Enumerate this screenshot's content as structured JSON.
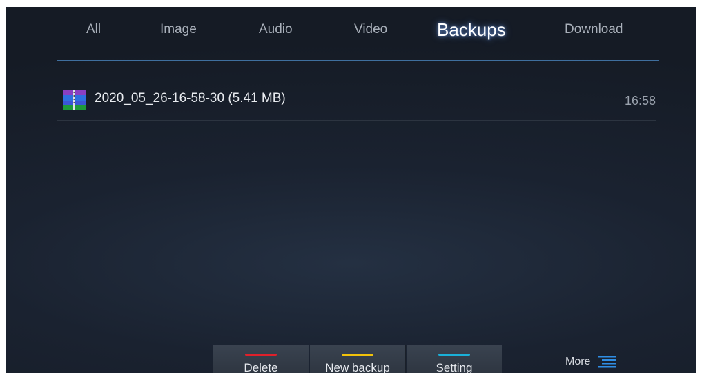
{
  "tabs": [
    {
      "label": "All",
      "active": false
    },
    {
      "label": "Image",
      "active": false
    },
    {
      "label": "Audio",
      "active": false
    },
    {
      "label": "Video",
      "active": false
    },
    {
      "label": "Backups",
      "active": true
    },
    {
      "label": "Download",
      "active": false
    }
  ],
  "files": [
    {
      "icon": "archive-icon",
      "name": "2020_05_26-16-58-30 (5.41 MB)",
      "time": "16:58"
    }
  ],
  "actions": [
    {
      "label": "Delete",
      "color": "#e0202a"
    },
    {
      "label": "New backup",
      "color": "#f2c20a"
    },
    {
      "label": "Setting",
      "color": "#1ab0d8"
    }
  ],
  "more": {
    "label": "More",
    "icon": "menu-lines-icon",
    "color": "#2f8de4"
  },
  "colors": {
    "accent": "#3f6f9e",
    "background": "#1a2230"
  }
}
